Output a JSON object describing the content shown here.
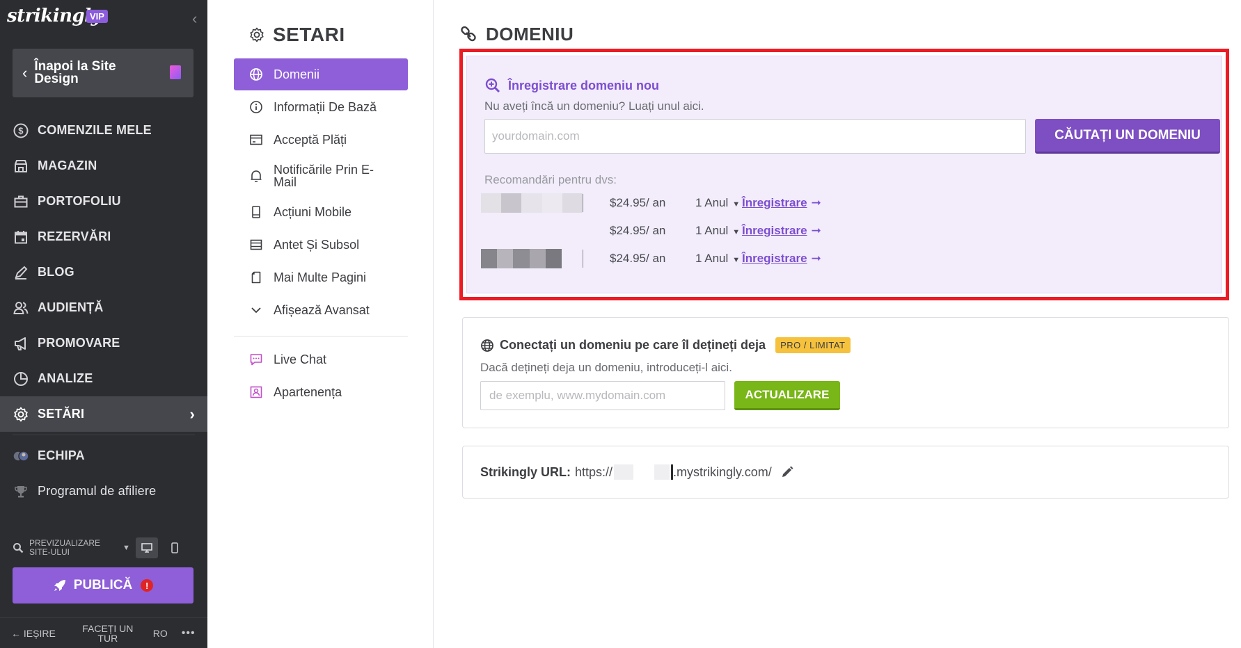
{
  "sidebar": {
    "brand": "strikingly",
    "vip": "VIP",
    "back": "Înapoi la Site Design",
    "items": [
      {
        "label": "COMENZILE MELE",
        "icon": "dollar-circle-icon"
      },
      {
        "label": "MAGAZIN",
        "icon": "store-icon"
      },
      {
        "label": "PORTOFOLIU",
        "icon": "briefcase-icon"
      },
      {
        "label": "REZERVĂRI",
        "icon": "calendar-icon"
      },
      {
        "label": "BLOG",
        "icon": "pen-icon"
      },
      {
        "label": "AUDIENȚĂ",
        "icon": "users-icon"
      },
      {
        "label": "PROMOVARE",
        "icon": "megaphone-icon"
      },
      {
        "label": "ANALIZE",
        "icon": "pie-chart-icon"
      },
      {
        "label": "SETĂRI",
        "icon": "gear-icon"
      }
    ],
    "team": "ECHIPA",
    "affiliate": "Programul de afiliere",
    "preview": "PREVIZUALIZARE SITE-ULUI",
    "publish": "PUBLICĂ",
    "publish_alert": "!",
    "exit": "IEȘIRE",
    "tour": "FACEȚI UN TUR",
    "lang": "RO",
    "more": "•••"
  },
  "settings": {
    "title": "SETARI",
    "items": [
      {
        "label": "Domenii"
      },
      {
        "label": "Informații De Bază"
      },
      {
        "label": "Acceptă Plăți"
      },
      {
        "label": "Notificările Prin E-Mail"
      },
      {
        "label": "Acțiuni Mobile"
      },
      {
        "label": "Antet Și Subsol"
      },
      {
        "label": "Mai Multe Pagini"
      },
      {
        "label": "Afișează Avansat"
      }
    ],
    "extra": [
      {
        "label": "Live Chat"
      },
      {
        "label": "Apartenența"
      }
    ]
  },
  "domain": {
    "title": "DOMENIU",
    "register": {
      "heading": "Înregistrare domeniu nou",
      "subtitle": "Nu aveți încă un domeniu? Luați unul aici.",
      "placeholder": "yourdomain.com",
      "button": "CĂUTAȚI UN DOMENIU",
      "rec_label": "Recomandări pentru dvs:",
      "rows": [
        {
          "price": "$24.95/ an",
          "period": "1 Anul",
          "link": "Înregistrare"
        },
        {
          "price": "$24.95/ an",
          "period": "1 Anul",
          "link": "Înregistrare"
        },
        {
          "price": "$24.95/ an",
          "period": "1 Anul",
          "link": "Înregistrare"
        }
      ]
    },
    "connect": {
      "heading": "Conectați un domeniu pe care îl dețineți deja",
      "badge": "PRO / LIMITAT",
      "subtitle": "Dacă dețineți deja un domeniu, introduceți-l aici.",
      "placeholder": "de exemplu, www.mydomain.com",
      "button": "ACTUALIZARE"
    },
    "url": {
      "label": "Strikingly URL:",
      "prefix": "https://",
      "suffix": ".mystrikingly.com/"
    }
  },
  "colors": {
    "accent": "#8e5fd9",
    "sidebar_bg": "#2c2d30",
    "highlight_border": "#ec1b24",
    "green": "#79b617",
    "badge": "#f6c23e"
  }
}
